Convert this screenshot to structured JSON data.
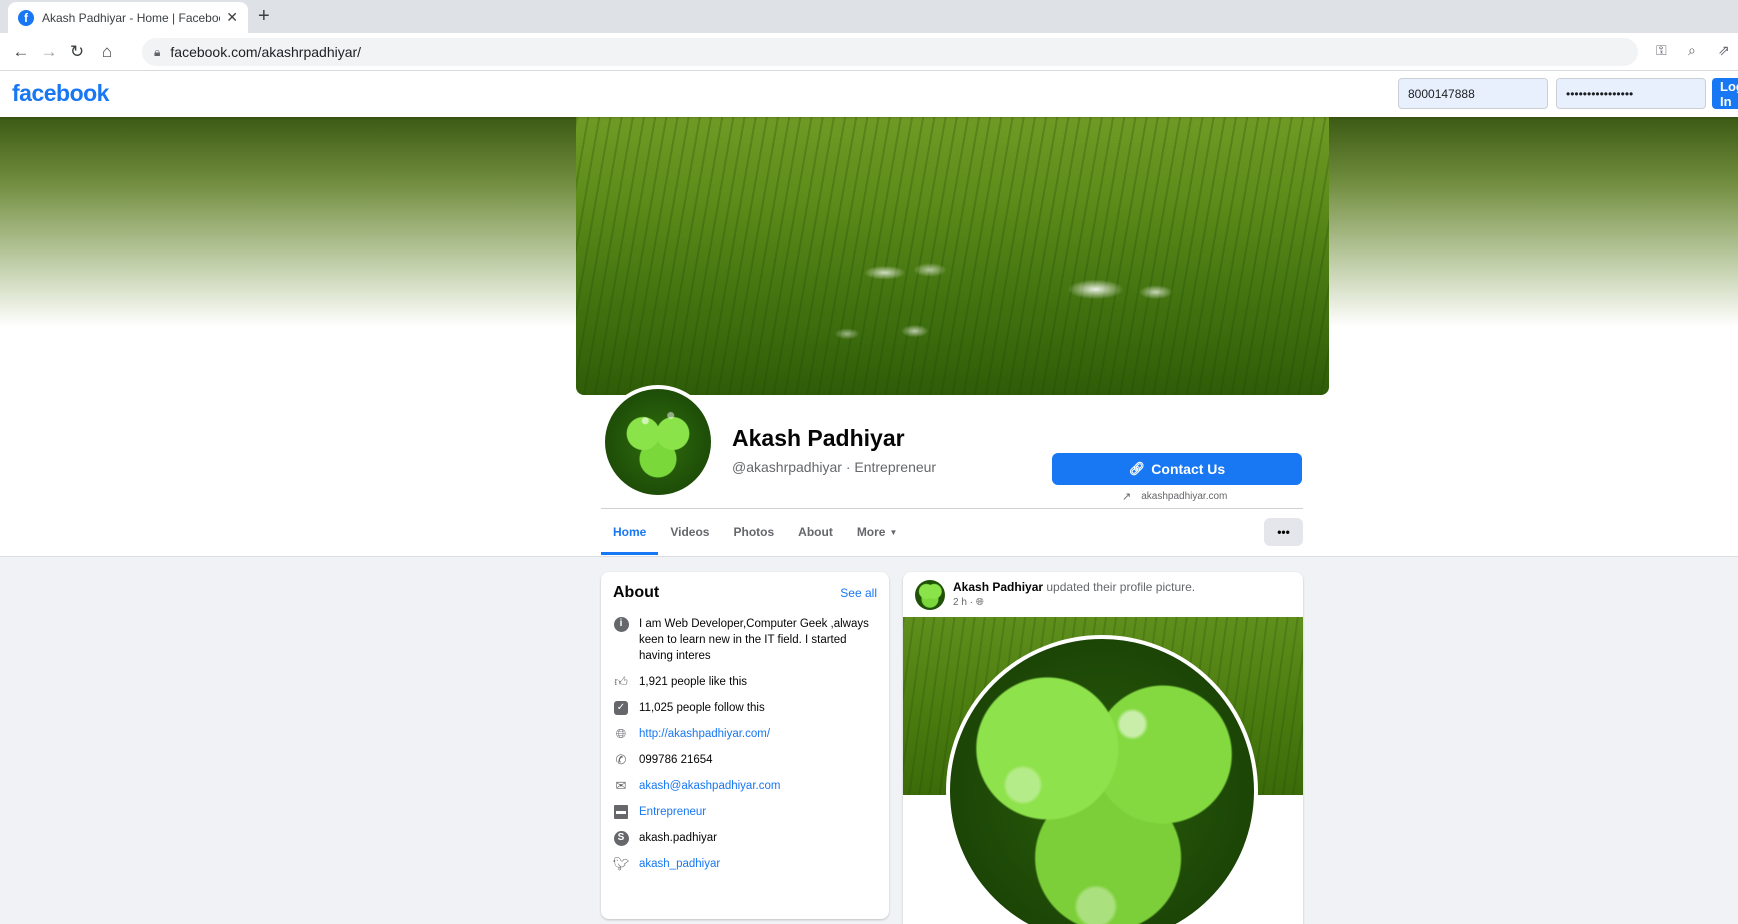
{
  "browser": {
    "tab_title": "Akash Padhiyar - Home | Facebook",
    "url": "facebook.com/akashrpadhiyar/"
  },
  "header": {
    "logo": "facebook",
    "email_value": "8000147888",
    "password_value": "••••••••••••••••",
    "login_label": "Log In"
  },
  "profile": {
    "name": "Akash Padhiyar",
    "handle": "@akashrpadhiyar · Entrepreneur",
    "contact_label": "Contact Us",
    "website": "akashpadhiyar.com"
  },
  "tabs": [
    "Home",
    "Videos",
    "Photos",
    "About",
    "More"
  ],
  "about": {
    "title": "About",
    "see_all": "See all",
    "description": "I am Web Developer,Computer Geek ,always keen to learn new in the IT field. I started having interes",
    "likes": "1,921 people like this",
    "follows": "11,025 people follow this",
    "website": "http://akashpadhiyar.com/",
    "phone": "099786 21654",
    "email": "akash@akashpadhiyar.com",
    "category": "Entrepreneur",
    "skype": "akash.padhiyar",
    "twitter": "akash_padhiyar"
  },
  "post": {
    "author": "Akash Padhiyar",
    "action": " updated their profile picture.",
    "time": "2 h · "
  },
  "colors": {
    "brand": "#1877f2",
    "background": "#f0f2f5"
  }
}
